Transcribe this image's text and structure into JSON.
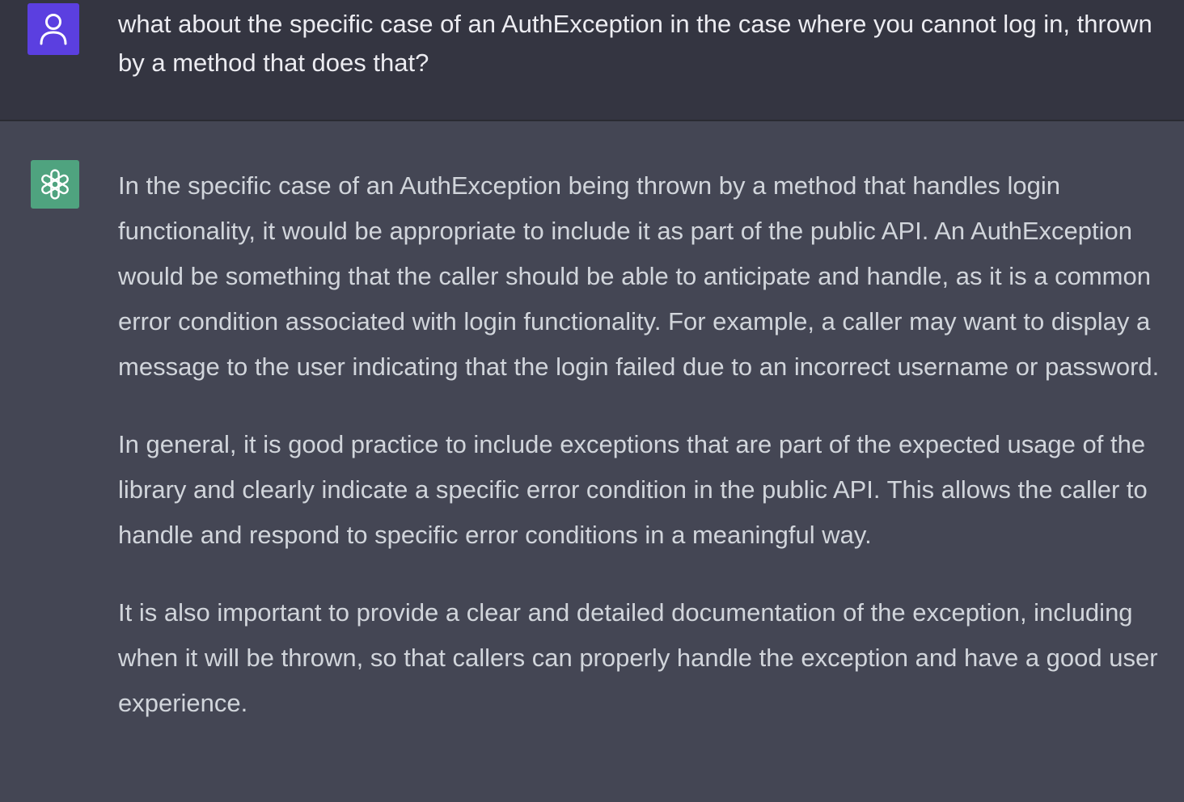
{
  "user_message": {
    "text": "what about the specific case of an AuthException in the case where you cannot log in, thrown by a method that does that?"
  },
  "assistant_message": {
    "paragraphs": [
      "In the specific case of an AuthException being thrown by a method that handles login functionality, it would be appropriate to include it as part of the public API. An AuthException would be something that the caller should be able to anticipate and handle, as it is a common error condition associated with login functionality. For example, a caller may want to display a message to the user indicating that the login failed due to an incorrect username or password.",
      "In general, it is good practice to include exceptions that are part of the expected usage of the library and clearly indicate a specific error condition in the public API. This allows the caller to handle and respond to specific error conditions in a meaningful way.",
      "It is also important to provide a clear and detailed documentation of the exception, including when it will be thrown, so that callers can properly handle the exception and have a good user experience."
    ]
  },
  "icons": {
    "user_avatar": "user-icon",
    "assistant_avatar": "openai-logo-icon"
  },
  "colors": {
    "user_bg": "#343541",
    "assistant_bg": "#444654",
    "user_avatar_bg": "#5b3fe0",
    "assistant_avatar_bg": "#4fa37f"
  }
}
